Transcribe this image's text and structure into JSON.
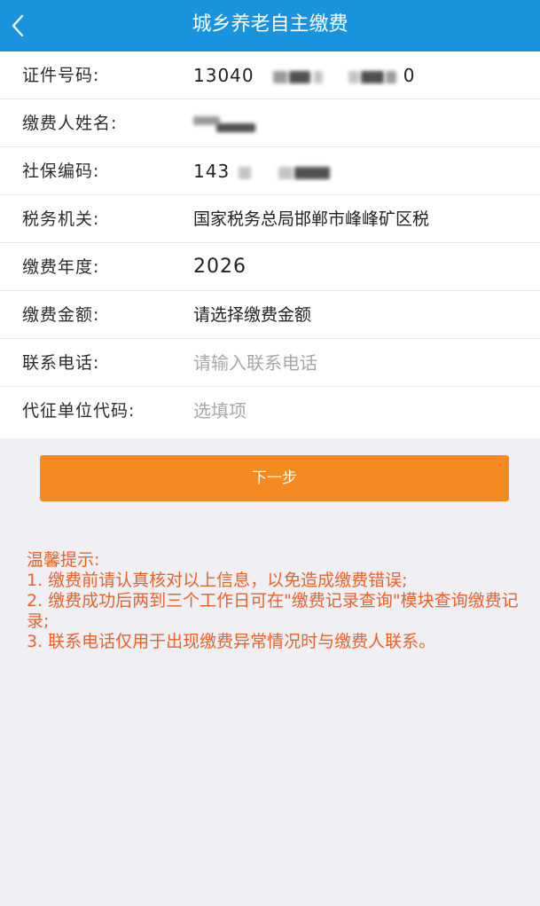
{
  "header": {
    "back_icon": "chevron-left-icon",
    "title": "城乡养老自主缴费",
    "color": "#1a93df"
  },
  "form": {
    "id_number": {
      "label": "证件号码:",
      "value_prefix": "13040",
      "value_suffix": "0"
    },
    "payer_name": {
      "label": "缴费人姓名:"
    },
    "social_security_code": {
      "label": "社保编码:",
      "value_prefix": "143"
    },
    "tax_authority": {
      "label": "税务机关:",
      "value": "国家税务总局邯郸市峰峰矿区税"
    },
    "payment_year": {
      "label": "缴费年度:",
      "value": "2026"
    },
    "payment_amount": {
      "label": "缴费金额:",
      "value": "请选择缴费金额"
    },
    "contact_phone": {
      "label": "联系电话:",
      "placeholder": "请输入联系电话"
    },
    "agent_unit_code": {
      "label": "代征单位代码:",
      "placeholder": "选填项"
    }
  },
  "next_button": {
    "label": "下一步",
    "color": "#f58a20"
  },
  "tips": {
    "color": "#e8622a",
    "lines": [
      "温馨提示:",
      "1. 缴费前请认真核对以上信息，以免造成缴费错误;",
      "2. 缴费成功后两到三个工作日可在\"缴费记录查询\"模块查询缴费记录;",
      "3. 联系电话仅用于出现缴费异常情况时与缴费人联系。"
    ]
  }
}
